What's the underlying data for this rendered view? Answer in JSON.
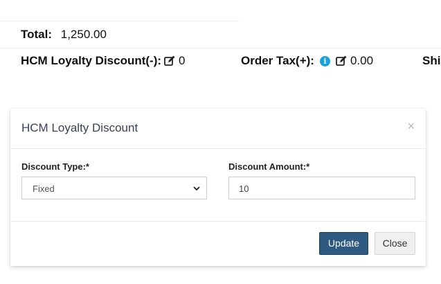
{
  "summary": {
    "total_label": "Total:",
    "total_value": "1,250.00",
    "loyalty_label": "HCM Loyalty Discount(-):",
    "loyalty_value": "0",
    "order_tax_label": "Order Tax(+):",
    "order_tax_value": "0.00",
    "shipping_label_partial": "Shi"
  },
  "modal": {
    "title": "HCM Loyalty Discount",
    "close_glyph": "×",
    "discount_type_label": "Discount Type:*",
    "discount_type_value": "Fixed",
    "discount_amount_label": "Discount Amount:*",
    "discount_amount_value": "10",
    "update_label": "Update",
    "close_label": "Close"
  },
  "colors": {
    "primary_button": "#2e5a82",
    "info_icon": "#17a2d8",
    "modal_title": "#3b3f5c"
  },
  "icons": [
    "edit-icon",
    "info-icon",
    "chevron-down-icon",
    "close-icon"
  ]
}
